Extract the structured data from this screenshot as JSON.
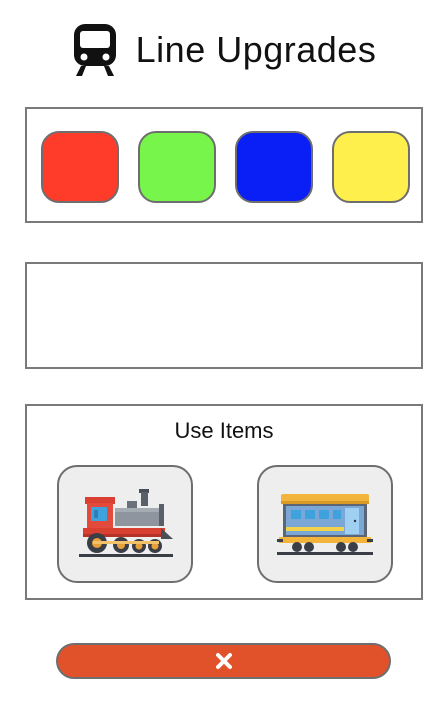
{
  "header": {
    "title": "Line Upgrades",
    "icon": "train-icon"
  },
  "colors": {
    "swatches": [
      {
        "name": "red",
        "hex": "#ff3b2a"
      },
      {
        "name": "green",
        "hex": "#77f54a"
      },
      {
        "name": "blue",
        "hex": "#0a1ff5"
      },
      {
        "name": "yellow",
        "hex": "#ffef4d"
      }
    ]
  },
  "items": {
    "title": "Use Items",
    "buttons": [
      {
        "icon": "locomotive-icon"
      },
      {
        "icon": "passenger-car-icon"
      }
    ]
  },
  "close": {
    "icon": "close-icon",
    "color": "#e1522b"
  }
}
